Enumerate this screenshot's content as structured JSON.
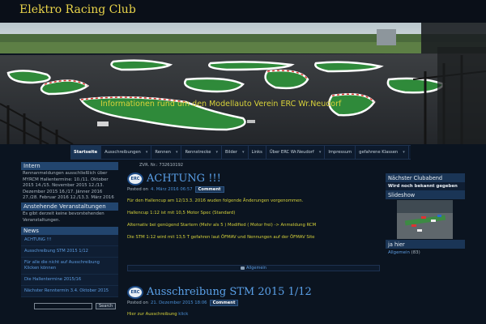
{
  "site": {
    "title": "Elektro Racing Club",
    "tagline": "Informationen rund um den Modellauto Verein ERC Wr.Neudorf"
  },
  "nav": {
    "items": [
      {
        "label": "Startseite",
        "active": true,
        "caret": false
      },
      {
        "label": "Ausschreibungen",
        "active": false,
        "caret": true
      },
      {
        "label": "Rennen",
        "active": false,
        "caret": true
      },
      {
        "label": "Rennstrecke",
        "active": false,
        "caret": true
      },
      {
        "label": "Bilder",
        "active": false,
        "caret": true
      },
      {
        "label": "Links",
        "active": false,
        "caret": false
      },
      {
        "label": "Über ERC Wr.Neudorf",
        "active": false,
        "caret": true
      },
      {
        "label": "Impressum",
        "active": false,
        "caret": false
      },
      {
        "label": "gefahrene Klassen",
        "active": false,
        "caret": true
      }
    ],
    "caret_glyph": "▾"
  },
  "zvr": "ZVR. Nr.: 732610192",
  "left": {
    "intern": {
      "heading": "Intern",
      "text": "Rennanmeldungen ausschließlich über MYRCM Hallentermine: 10./11. Oktober 2015 14./15. November 2015 12./13. Dezember 2015 16./17. Jänner 2016 27./28. Februar 2016 12./13.3. März 2016"
    },
    "events": {
      "heading": "Anstehende Veranstaltungen",
      "text": "Es gibt derzeit keine bevorstehenden Veranstaltungen."
    },
    "news": {
      "heading": "News",
      "items": [
        "ACHTUNG !!!",
        "Ausschreibung STM 2015 1/12",
        "Für alle die nicht auf Ausschreibung Klicken können",
        "Die Hallentermine 2015/16",
        "Nächster Renntermin 3.4. Oktober 2015"
      ]
    },
    "search": {
      "button": "Search",
      "value": ""
    }
  },
  "posts": [
    {
      "badge": "ERC",
      "title": "ACHTUNG !!!",
      "posted_on": "Posted on",
      "date": "4. März 2016 06:57",
      "comment_label": "Comment",
      "paragraphs": [
        "Für den Hallencup am 12/13.3. 2016 wuden folgende Änderungen vorgenommen.",
        "Hallencup 1:12 ist mit 10,5 Motor Spec (Standard)",
        "Alternativ bei genügend Startern (Mehr als 5 ) Modified ( Motor  frei) -> Anmeldung RCM",
        "Die STM 1:12 wird mit 13,5 T gefahren laut ÖFMAV und Nennungen auf der ÖFMAV Site"
      ],
      "category": "Allgemein"
    },
    {
      "badge": "ERC",
      "title": "Ausschreibung STM 2015 1/12",
      "posted_on": "Posted on",
      "date": "21. Dezember 2015 18:06",
      "comment_label": "Comment",
      "body_text": "Hier zur Ausschreibung",
      "body_link": "klick"
    }
  ],
  "right": {
    "next_club_evening": {
      "heading": "Nächster Clubabend",
      "text": "Wird noch bekannt gegeben"
    },
    "slideshow": {
      "heading": "Slideshow"
    },
    "ja_hier": {
      "heading": "ja hier",
      "category": "Allgemein",
      "count": "(83)"
    }
  },
  "colors": {
    "background": "#0b1420",
    "title_yellow": "#e9d44a",
    "link_blue": "#5aa0e8",
    "widget_head": "#22456e",
    "body_yellow": "#d6d23a"
  }
}
